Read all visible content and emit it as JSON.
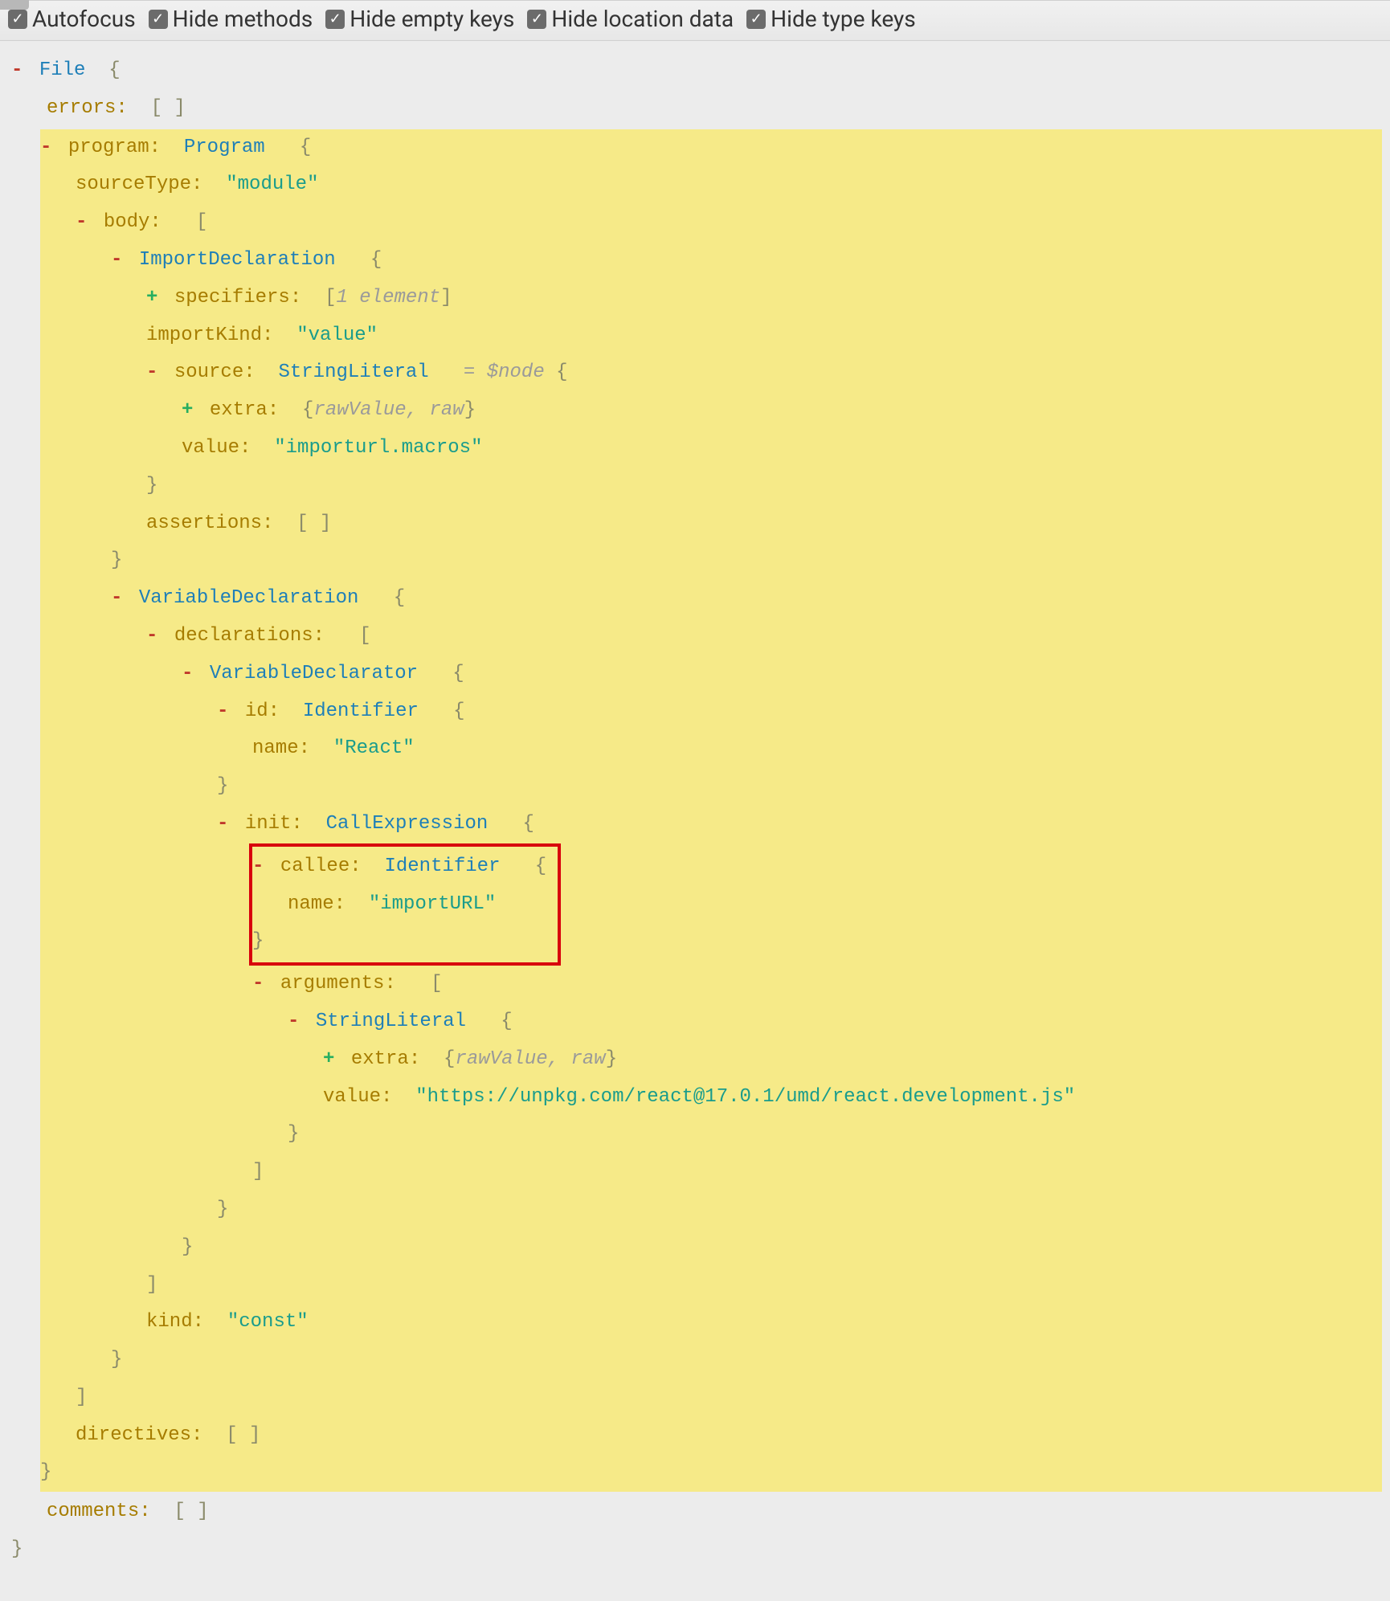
{
  "toolbar": {
    "autofocus": "Autofocus",
    "hideMethods": "Hide methods",
    "hideEmptyKeys": "Hide empty keys",
    "hideLocationData": "Hide location data",
    "hideTypeKeys": "Hide type keys"
  },
  "punct": {
    "minus": "-",
    "plus": "+",
    "colon": ":",
    "openBrace": "{",
    "closeBrace": "}",
    "openBracket": "[",
    "closeBracket": "]",
    "emptyArr": "[ ]",
    "equals": "="
  },
  "keys": {
    "errors": "errors",
    "program": "program",
    "sourceType": "sourceType",
    "body": "body",
    "specifiers": "specifiers",
    "importKind": "importKind",
    "source": "source",
    "extra": "extra",
    "value": "value",
    "assertions": "assertions",
    "declarations": "declarations",
    "id": "id",
    "name": "name",
    "init": "init",
    "callee": "callee",
    "arguments": "arguments",
    "kind": "kind",
    "directives": "directives",
    "comments": "comments"
  },
  "types": {
    "File": "File",
    "Program": "Program",
    "ImportDeclaration": "ImportDeclaration",
    "StringLiteral": "StringLiteral",
    "VariableDeclaration": "VariableDeclaration",
    "VariableDeclarator": "VariableDeclarator",
    "Identifier": "Identifier",
    "CallExpression": "CallExpression"
  },
  "meta": {
    "oneElement": "1 element",
    "dollarNode": "$node",
    "extraFields": "rawValue, raw"
  },
  "values": {
    "sourceType": "\"module\"",
    "importKind": "\"value\"",
    "sourceValue": "\"importurl.macros\"",
    "idName": "\"React\"",
    "calleeName": "\"importURL\"",
    "argValue": "\"https://unpkg.com/react@17.0.1/umd/react.development.js\"",
    "kind": "\"const\""
  }
}
